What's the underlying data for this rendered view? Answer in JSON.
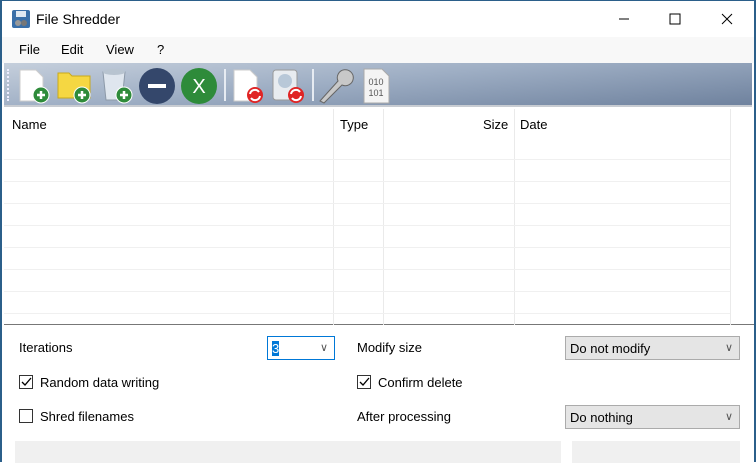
{
  "window": {
    "title": "File Shredder"
  },
  "menu": [
    "File",
    "Edit",
    "View",
    "?"
  ],
  "toolbar": [
    {
      "icon": "add-file-icon"
    },
    {
      "icon": "add-folder-icon"
    },
    {
      "icon": "add-recycle-bin-icon"
    },
    {
      "icon": "remove-icon"
    },
    {
      "icon": "clear-icon",
      "glyph": "X"
    },
    {
      "icon": "shred-file-icon"
    },
    {
      "icon": "shred-drive-icon"
    },
    {
      "icon": "settings-wrench-icon"
    },
    {
      "icon": "binary-file-icon",
      "glyph": "010\n101"
    }
  ],
  "list": {
    "columns": [
      "Name",
      "Type",
      "Size",
      "Date"
    ],
    "rows": []
  },
  "options": {
    "iterations_label": "Iterations",
    "iterations_value": "3",
    "modify_size_label": "Modify size",
    "modify_size_value": "Do not modify",
    "random_data_label": "Random data writing",
    "random_data_checked": true,
    "confirm_delete_label": "Confirm delete",
    "confirm_delete_checked": true,
    "shred_filenames_label": "Shred filenames",
    "shred_filenames_checked": false,
    "after_processing_label": "After processing",
    "after_processing_value": "Do nothing"
  },
  "colors": {
    "green": "#2e8b3a",
    "navy": "#34476b",
    "red": "#e02424",
    "accent": "#0078d7"
  }
}
